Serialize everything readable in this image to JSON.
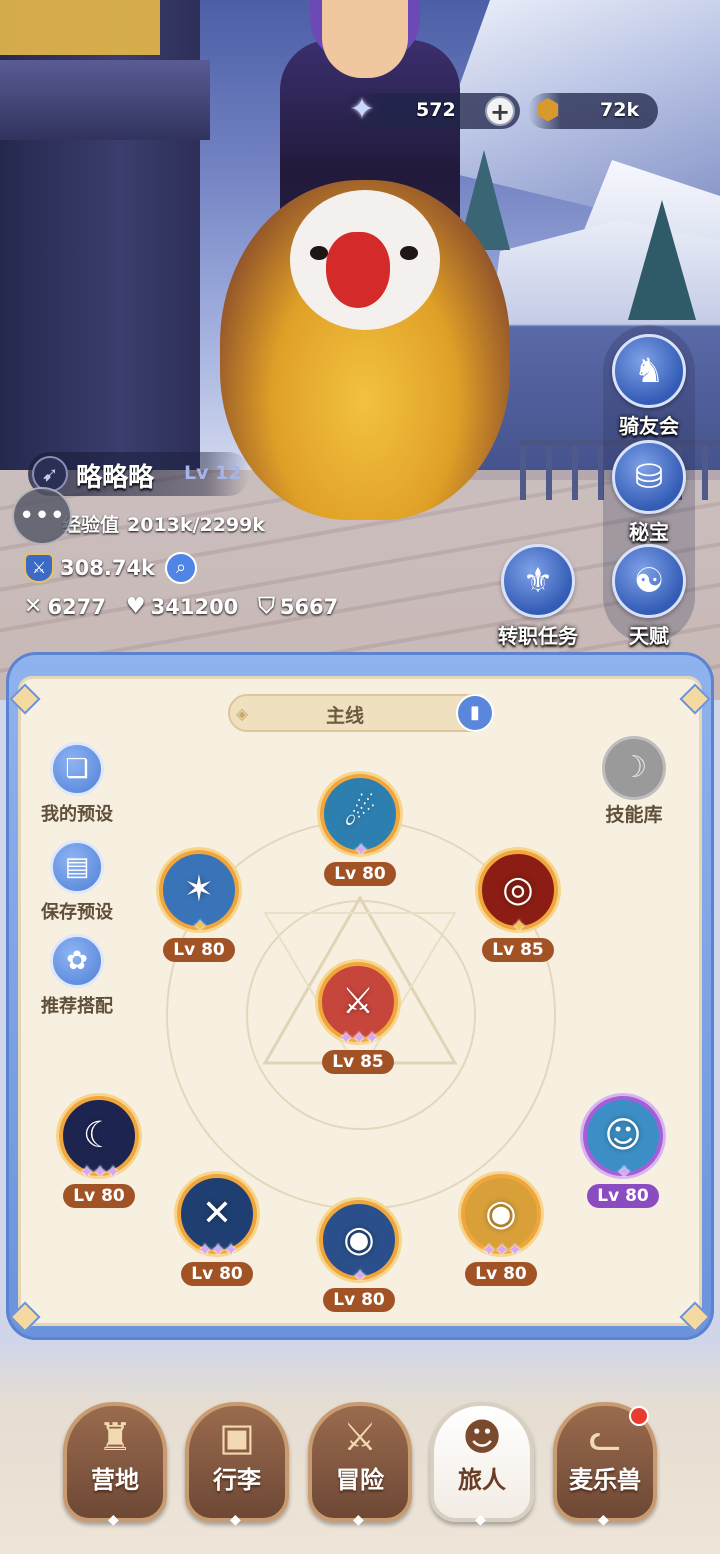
{
  "currency": {
    "gems": "572",
    "gold": "72k",
    "gem_icon": "star-crystal-icon",
    "gold_icon": "coin-icon"
  },
  "player": {
    "name": "略略略",
    "level": "Lv 12",
    "exp_label": "经验值",
    "exp_value": "2013k/2299k",
    "power": "308.74k",
    "attack": "6277",
    "hp": "341200",
    "defense": "5667"
  },
  "side_buttons": {
    "mount_club": "骑友会",
    "treasure": "秘宝",
    "job_quest": "转职任务",
    "talent": "天赋"
  },
  "panel": {
    "tab_label": "主线",
    "presets": [
      {
        "label": "我的预设"
      },
      {
        "label": "保存预设"
      },
      {
        "label": "推荐搭配"
      }
    ],
    "skill_library": "技能库",
    "skills": [
      {
        "id": "top",
        "level": "Lv 80",
        "stars": "✦",
        "color": "#2d7fb0",
        "glyph": "☄"
      },
      {
        "id": "left",
        "level": "Lv 80",
        "stars": "✦",
        "color": "#3a74b8",
        "glyph": "✶"
      },
      {
        "id": "right",
        "level": "Lv 85",
        "stars": "✦",
        "color": "#8b1d14",
        "glyph": "◎"
      },
      {
        "id": "center",
        "level": "Lv 85",
        "stars": "✦✦✦",
        "color": "#c6463c",
        "glyph": "⚔"
      },
      {
        "id": "bottom-1",
        "level": "Lv 80",
        "stars": "✦✦✦",
        "color": "#1d2450",
        "glyph": "☾"
      },
      {
        "id": "bottom-2",
        "level": "Lv 80",
        "stars": "✦✦✦",
        "color": "#1f3f73",
        "glyph": "✕"
      },
      {
        "id": "bottom-3",
        "level": "Lv 80",
        "stars": "✦",
        "color": "#2a4f8a",
        "glyph": "◉"
      },
      {
        "id": "bottom-4",
        "level": "Lv 80",
        "stars": "✦✦✦",
        "color": "#d9a03a",
        "glyph": "◉"
      },
      {
        "id": "bottom-5",
        "level": "Lv 80",
        "stars": "✦",
        "color": "#3c8fc6",
        "glyph": "☺"
      }
    ]
  },
  "nav": {
    "camp": "营地",
    "bag": "行李",
    "adventure": "冒险",
    "traveler": "旅人",
    "pets": "麦乐兽",
    "active": "traveler"
  }
}
